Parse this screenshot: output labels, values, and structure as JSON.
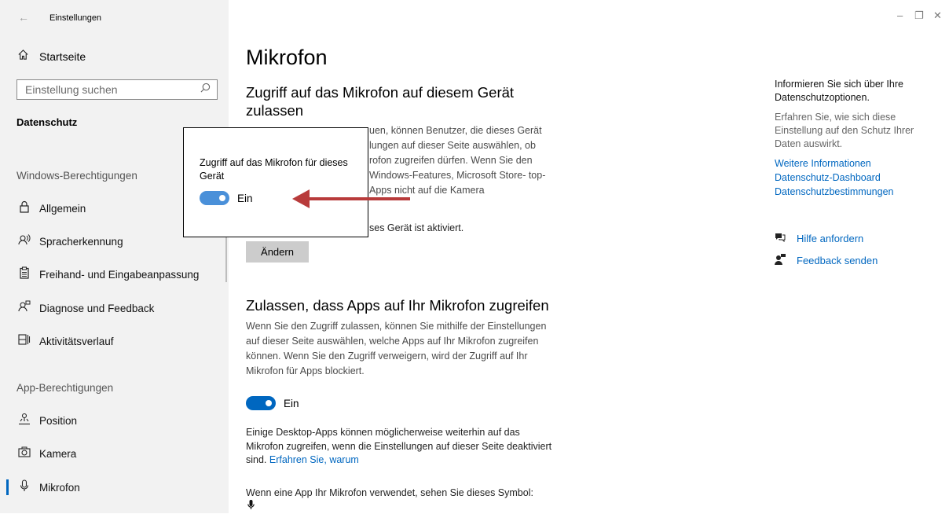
{
  "window": {
    "title": "Einstellungen",
    "back_icon": "←",
    "minimize_icon": "–",
    "restore_icon": "❐",
    "close_icon": "✕"
  },
  "sidebar": {
    "home_label": "Startseite",
    "search_placeholder": "Einstellung suchen",
    "current_section": "Datenschutz",
    "group_windows": "Windows-Berechtigungen",
    "windows_items": [
      {
        "label": "Allgemein",
        "icon": "lock-icon"
      },
      {
        "label": "Spracherkennung",
        "icon": "speech-icon"
      },
      {
        "label": "Freihand- und Eingabeanpassung",
        "icon": "clipboard-icon"
      },
      {
        "label": "Diagnose und Feedback",
        "icon": "feedback-icon"
      },
      {
        "label": "Aktivitätsverlauf",
        "icon": "timeline-icon"
      }
    ],
    "group_apps": "App-Berechtigungen",
    "app_items": [
      {
        "label": "Position",
        "icon": "location-icon"
      },
      {
        "label": "Kamera",
        "icon": "camera-icon"
      },
      {
        "label": "Mikrofon",
        "icon": "microphone-icon",
        "selected": true
      }
    ]
  },
  "main": {
    "page_title": "Mikrofon",
    "section1": {
      "heading": "Zugriff auf das Mikrofon auf diesem Gerät zulassen",
      "description_tail": "uen, können Benutzer, die dieses Gerät lungen auf dieser Seite auswählen, ob rofon zugreifen dürfen. Wenn Sie den Windows-Features, Microsoft Store- top-Apps nicht auf die Kamera",
      "status_tail": "ses Gerät ist aktiviert.",
      "change_button": "Ändern"
    },
    "section2": {
      "heading": "Zulassen, dass Apps auf Ihr Mikrofon zugreifen",
      "description": "Wenn Sie den Zugriff zulassen, können Sie mithilfe der Einstellungen auf dieser Seite auswählen, welche Apps auf Ihr Mikrofon zugreifen können. Wenn Sie den Zugriff verweigern, wird der Zugriff auf Ihr Mikrofon für Apps blockiert.",
      "toggle_state": "Ein",
      "desktop_note": "Einige Desktop-Apps können möglicherweise weiterhin auf das Mikrofon zugreifen, wenn die Einstellungen auf dieser Seite deaktiviert sind.",
      "desktop_link": "Erfahren Sie, warum",
      "symbol_note": "Wenn eine App Ihr Mikrofon verwendet, sehen Sie dieses Symbol:"
    },
    "popup": {
      "title": "Zugriff auf das Mikrofon für dieses Gerät",
      "toggle_state": "Ein"
    }
  },
  "right": {
    "heading": "Informieren Sie sich über Ihre Datenschutzoptionen.",
    "text": "Erfahren Sie, wie sich diese Einstellung auf den Schutz Ihrer Daten auswirkt.",
    "links": [
      "Weitere Informationen",
      "Datenschutz-Dashboard",
      "Datenschutzbestimmungen"
    ],
    "help": "Hilfe anfordern",
    "feedback": "Feedback senden"
  },
  "colors": {
    "accent": "#0067c0",
    "arrow": "#b83b3b",
    "sidebar_bg": "#f2f2f2"
  }
}
